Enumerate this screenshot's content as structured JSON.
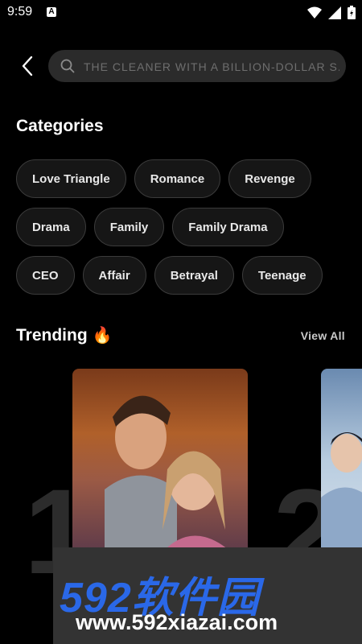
{
  "status": {
    "time": "9:59",
    "notification_letter": "A"
  },
  "search": {
    "placeholder": "THE CLEANER WITH A BILLION-DOLLAR S..."
  },
  "categories": {
    "title": "Categories",
    "rows": [
      [
        "Love Triangle",
        "Romance",
        "Revenge"
      ],
      [
        "Drama",
        "Family",
        "Family Drama"
      ],
      [
        "CEO",
        "Affair",
        "Betrayal",
        "Teenage"
      ]
    ]
  },
  "trending": {
    "title": "Trending",
    "emoji": "🔥",
    "view_all": "View All",
    "ranks": [
      "1",
      "2"
    ]
  },
  "watermark": {
    "brand": "592软件园",
    "url": "www.592xiazai.com"
  },
  "colors": {
    "background": "#000000",
    "chip_bg": "#161616",
    "chip_border": "#3b3b3b",
    "search_bg": "#2b2b2b",
    "watermark_blue": "#2a68e8"
  }
}
